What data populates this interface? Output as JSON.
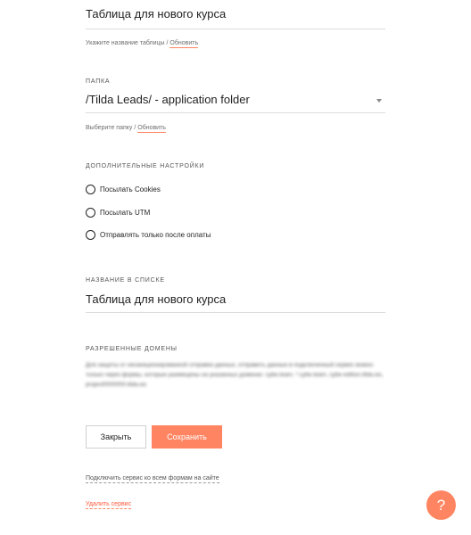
{
  "table_name": {
    "value": "Таблица для нового курса",
    "hint_text": "Укажите название таблицы / ",
    "hint_link": "Обновить"
  },
  "folder": {
    "label": "ПАПКА",
    "value": "/Tilda Leads/ - application folder",
    "hint_text": "Выберите папку / ",
    "hint_link": "Обновить"
  },
  "extra_settings": {
    "label": "ДОПОЛНИТЕЛЬНЫЕ НАСТРОЙКИ",
    "options": [
      {
        "label": "Посылать Cookies",
        "checked": false
      },
      {
        "label": "Посылать UTM",
        "checked": false
      },
      {
        "label": "Отправлять только после оплаты",
        "checked": false
      }
    ]
  },
  "list_name": {
    "label": "НАЗВАНИЕ В СПИСКЕ",
    "value": "Таблица для нового курса"
  },
  "allowed_domains": {
    "label": "РАЗРЕШЕННЫЕ ДОМЕНЫ",
    "description": "Для защиты от несанкционированной отправки данных, отправить данные в подключенный сервис можно только через формы, которые размещены на указанных доменах: cybe.team, *.cybe.team, cybe-edition.tilda.ws, project0000000.tilda.ws"
  },
  "buttons": {
    "close": "Закрыть",
    "save": "Сохранить"
  },
  "links": {
    "connect_all": "Подключить сервис ко всем формам на сайте",
    "delete": "Удалить сервис"
  },
  "help": {
    "icon": "question-mark-icon",
    "glyph": "?"
  },
  "colors": {
    "accent": "#ff8562",
    "link_underline": "#ff8562"
  }
}
